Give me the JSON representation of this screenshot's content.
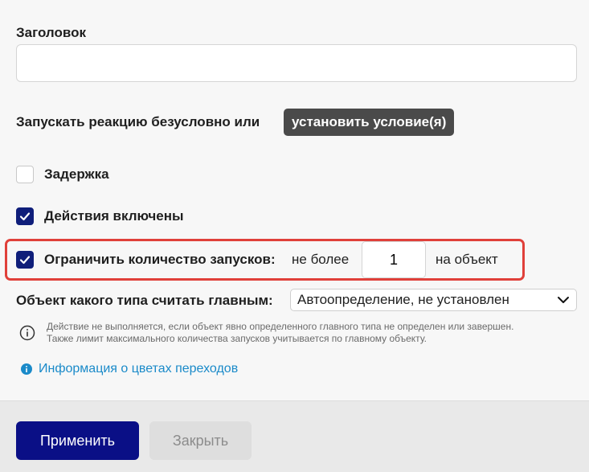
{
  "form": {
    "title_label": "Заголовок",
    "title_value": "",
    "run_label": "Запускать реакцию безусловно или",
    "condition_button": "установить условие(я)",
    "delay": {
      "label": "Задержка",
      "checked": false
    },
    "actions_enabled": {
      "label": "Действия включены",
      "checked": true
    },
    "limit": {
      "label": "Ограничить количество запусков:",
      "checked": true,
      "prefix": "не более",
      "value": "1",
      "suffix": "на объект"
    },
    "main_type": {
      "label": "Объект какого типа считать главным:",
      "selected": "Автоопределение, не установлен"
    },
    "note_line1": "Действие не выполняется, если объект явно определенного главного типа не определен или завершен.",
    "note_line2": "Также лимит максимального количества запусков учитывается по главному объекту.",
    "colors_link": "Информация о цветах переходов"
  },
  "footer": {
    "apply_button": "Применить",
    "close_button": "Закрыть"
  },
  "colors": {
    "primary": "#0a0f86",
    "checkbox": "#0f1e7a",
    "highlight": "#e0403a",
    "link": "#1a8ac9",
    "condition_button_bg": "#4a4a4a"
  }
}
